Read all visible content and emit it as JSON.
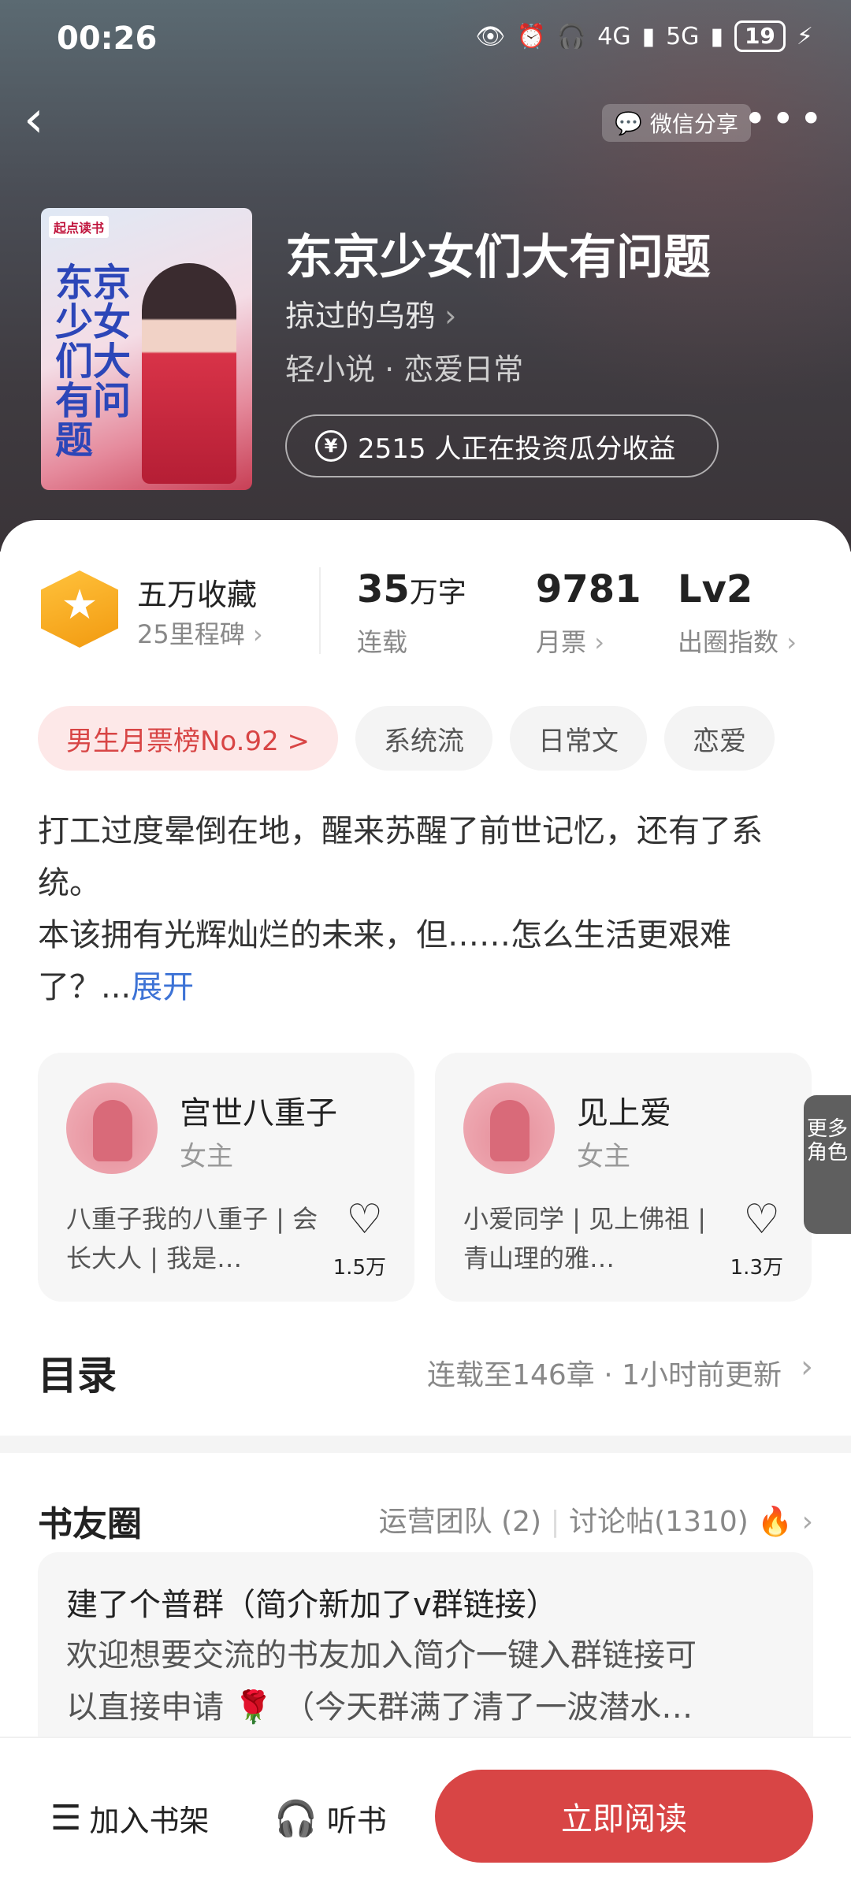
{
  "status": {
    "time": "00:26",
    "network_a": "4G",
    "network_b": "5G",
    "battery": "19"
  },
  "nav": {
    "back_icon": "chevron-left-icon",
    "share_label": "微信分享",
    "more_icon": "more-icon"
  },
  "cover": {
    "brand": "起点读书",
    "title": "东京少女们大有问题"
  },
  "book": {
    "title": "东京少女们大有问题",
    "author": "掠过的乌鸦",
    "genre": "轻小说 · 恋爱日常",
    "invest": "2515 人正在投资瓜分收益"
  },
  "stats": {
    "favorites": "五万收藏",
    "milestone": "25里程碑",
    "words_num": "35",
    "words_unit": "万字",
    "words_label": "连载",
    "monthly_votes": "9781",
    "monthly_label": "月票",
    "level": "Lv2",
    "level_label": "出圈指数"
  },
  "tags": [
    "男生月票榜No.92 >",
    "系统流",
    "日常文",
    "恋爱"
  ],
  "intro": {
    "line1": "打工过度晕倒在地，醒来苏醒了前世记忆，还有了系统。",
    "line2": "本该拥有光辉灿烂的未来，但……怎么生活更艰难了？...",
    "expand": "展开"
  },
  "roles": [
    {
      "name": "宫世八重子",
      "type": "女主",
      "desc": "八重子我的八重子 | 会长大人 | 我是…",
      "likes": "1.5万"
    },
    {
      "name": "见上爱",
      "type": "女主",
      "desc": "小爱同学 | 见上佛祖 | 青山理的雅…",
      "likes": "1.3万"
    }
  ],
  "more_roles": "更多角色",
  "toc": {
    "title": "目录",
    "status": "连载至146章 · 1小时前更新"
  },
  "circle": {
    "title": "书友圈",
    "team": "运营团队 (2)",
    "posts": "讨论帖(1310)",
    "post_title": "建了个普群（简介新加了v群链接）",
    "post_body1": "欢迎想要交流的书友加入简介一键入群链接可",
    "post_body2": "以直接申请",
    "post_body3": "（今天群满了清了一波潜水…"
  },
  "bottom": {
    "shelf": "加入书架",
    "listen": "听书",
    "read": "立即阅读"
  },
  "colors": {
    "accent": "#d84545",
    "link": "#3d73d6",
    "badge": "#f5a623"
  }
}
